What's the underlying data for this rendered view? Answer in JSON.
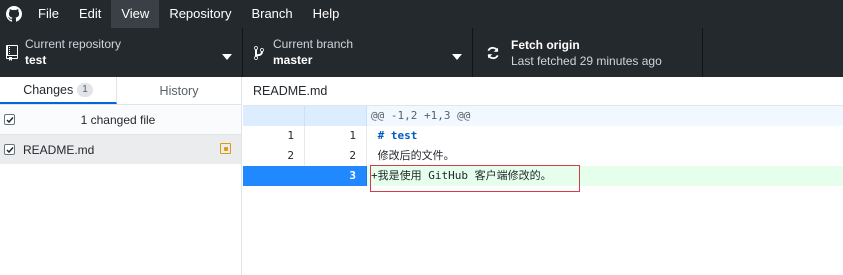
{
  "menu": {
    "items": [
      {
        "label": "File"
      },
      {
        "label": "Edit"
      },
      {
        "label": "View"
      },
      {
        "label": "Repository"
      },
      {
        "label": "Branch"
      },
      {
        "label": "Help"
      }
    ]
  },
  "toolbar": {
    "repository": {
      "label": "Current repository",
      "value": "test"
    },
    "branch": {
      "label": "Current branch",
      "value": "master"
    },
    "fetch": {
      "label": "Fetch origin",
      "status": "Last fetched 29 minutes ago"
    }
  },
  "sidebar": {
    "tabs": {
      "changes": "Changes",
      "changes_count": "1",
      "history": "History"
    },
    "summary": "1 changed file",
    "files": [
      {
        "name": "README.md",
        "status": "modified"
      }
    ]
  },
  "diff": {
    "file": "README.md",
    "hunk_header": "@@ -1,2 +1,3 @@",
    "lines": [
      {
        "old": "1",
        "new": "1",
        "text": " # test"
      },
      {
        "old": "2",
        "new": "2",
        "text": " 修改后的文件。"
      },
      {
        "old": "",
        "new": "3",
        "text": "+我是使用 GitHub 客户端修改的。"
      }
    ]
  },
  "colors": {
    "titlebar": "#24292e",
    "accent": "#0366d6",
    "added_bg": "#e6ffed",
    "added_gutter": "#2188ff",
    "hunk_bg": "#f1f8ff",
    "modified_icon": "#d99e0b",
    "highlight_box": "#d73a49"
  }
}
